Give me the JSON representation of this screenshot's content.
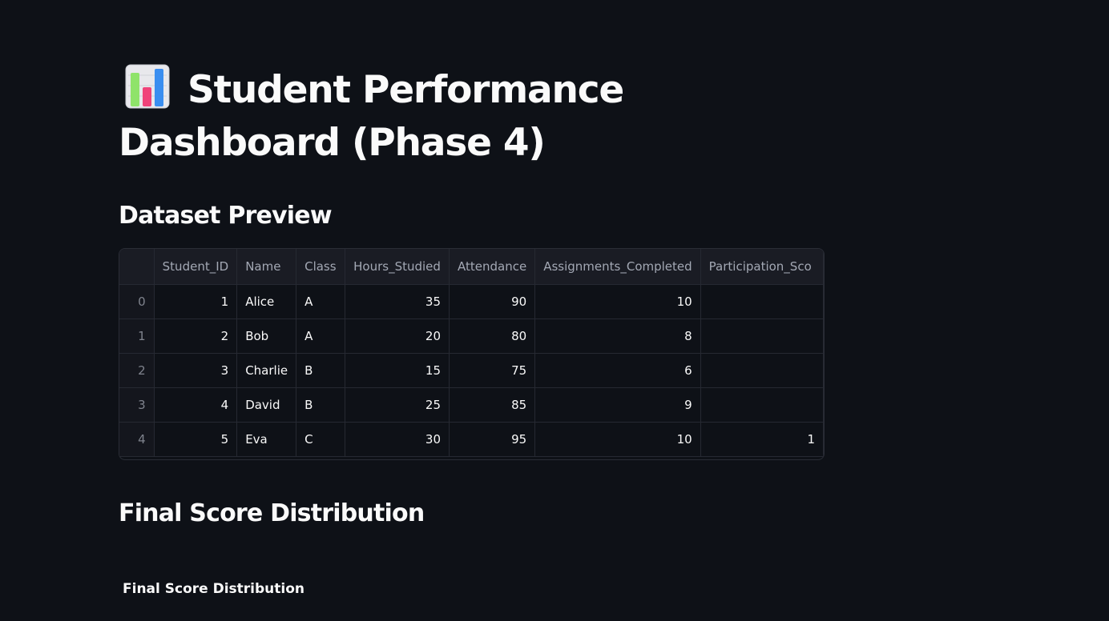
{
  "header": {
    "title": "Student Performance Dashboard (Phase 4)",
    "title_icon": "bar-chart-emoji-icon"
  },
  "dataset_preview": {
    "heading": "Dataset Preview",
    "columns": [
      "",
      "Student_ID",
      "Name",
      "Class",
      "Hours_Studied",
      "Attendance",
      "Assignments_Completed",
      "Participation_Sco"
    ],
    "rows": [
      [
        "0",
        "1",
        "Alice",
        "A",
        "35",
        "90",
        "10",
        ""
      ],
      [
        "1",
        "2",
        "Bob",
        "A",
        "20",
        "80",
        "8",
        ""
      ],
      [
        "2",
        "3",
        "Charlie",
        "B",
        "15",
        "75",
        "6",
        ""
      ],
      [
        "3",
        "4",
        "David",
        "B",
        "25",
        "85",
        "9",
        ""
      ],
      [
        "4",
        "5",
        "Eva",
        "C",
        "30",
        "95",
        "10",
        "1"
      ]
    ]
  },
  "final_score": {
    "heading": "Final Score Distribution",
    "chart_title": "Final Score Distribution"
  },
  "colors": {
    "background": "#0e1117",
    "text": "#fafafa",
    "table_header_bg": "#1a1c24",
    "table_border": "#262932"
  }
}
